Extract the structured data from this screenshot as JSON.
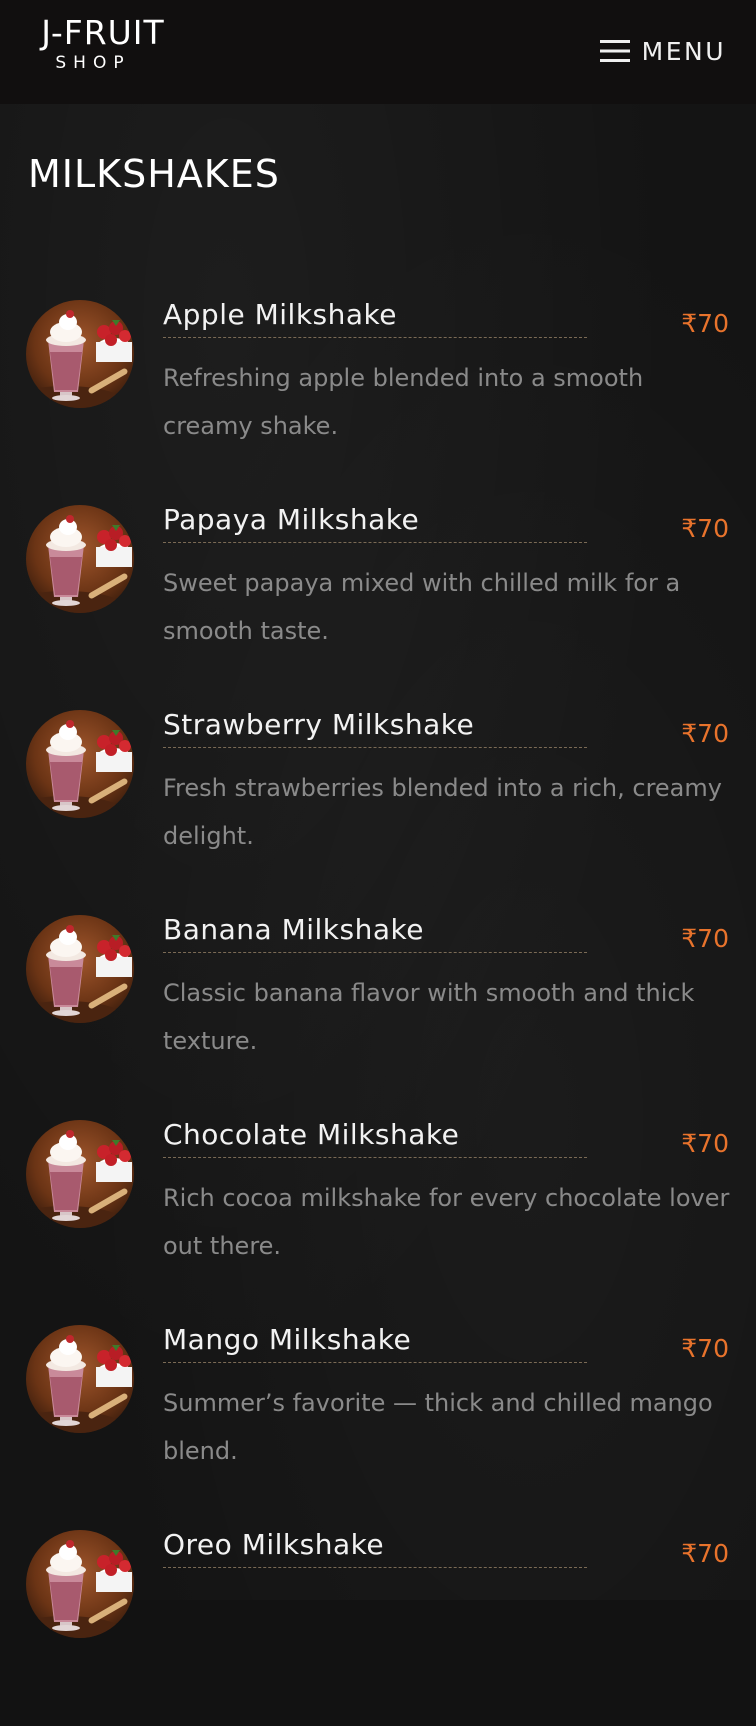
{
  "header": {
    "logo_main": "J-FRUIT",
    "logo_sub": "SHOP",
    "menu_label": "MENU",
    "menu_icon": "hamburger-icon"
  },
  "page": {
    "title": "MILKSHAKES"
  },
  "colors": {
    "background": "#141414",
    "header_bg": "#110f0f",
    "price": "#e8732c",
    "description": "#8a8a8a",
    "dots": "#7a6a55"
  },
  "items": [
    {
      "name": "Apple Milkshake",
      "price": "₹70",
      "description": "Refreshing apple blended into a smooth creamy shake."
    },
    {
      "name": "Papaya Milkshake",
      "price": "₹70",
      "description": "Sweet papaya mixed with chilled milk for a smooth taste."
    },
    {
      "name": "Strawberry Milkshake",
      "price": "₹70",
      "description": "Fresh strawberries blended into a rich, creamy delight."
    },
    {
      "name": "Banana Milkshake",
      "price": "₹70",
      "description": "Classic banana flavor with smooth and thick texture."
    },
    {
      "name": "Chocolate Milkshake",
      "price": "₹70",
      "description": "Rich cocoa milkshake for every chocolate lover out there."
    },
    {
      "name": "Mango Milkshake",
      "price": "₹70",
      "description": "Summer’s favorite — thick and chilled mango blend."
    },
    {
      "name": "Oreo Milkshake",
      "price": "₹70",
      "description": ""
    }
  ]
}
